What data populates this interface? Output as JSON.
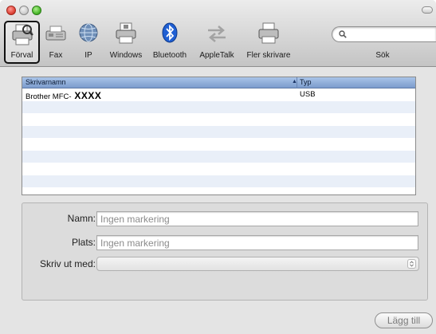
{
  "toolbar": {
    "items": [
      {
        "label": "Förval",
        "icon": "printer-default-icon",
        "selected": true
      },
      {
        "label": "Fax",
        "icon": "fax-icon"
      },
      {
        "label": "IP",
        "icon": "globe-icon"
      },
      {
        "label": "Windows",
        "icon": "windows-printer-icon"
      },
      {
        "label": "Bluetooth",
        "icon": "bluetooth-icon"
      },
      {
        "label": "AppleTalk",
        "icon": "appletalk-arrows-icon"
      },
      {
        "label": "Fler skrivare",
        "icon": "more-printers-icon"
      }
    ],
    "search_label": "Sök",
    "search_value": ""
  },
  "printer_list": {
    "columns": {
      "name": "Skrivarnamn",
      "type": "Typ"
    },
    "rows": [
      {
        "name_prefix": "Brother MFC-",
        "name_model": " XXXX",
        "type": "USB"
      }
    ]
  },
  "details": {
    "name_label": "Namn:",
    "name_value": "Ingen markering",
    "location_label": "Plats:",
    "location_value": "Ingen markering",
    "print_using_label": "Skriv ut med:",
    "print_using_value": ""
  },
  "add_button_label": "Lägg till",
  "colors": {
    "header_blue": "#7c9ccd",
    "row_stripe": "#e9eff8",
    "close_red": "#e0463a",
    "zoom_green": "#4fbb2f",
    "bluetooth_blue": "#1f5fd3"
  }
}
